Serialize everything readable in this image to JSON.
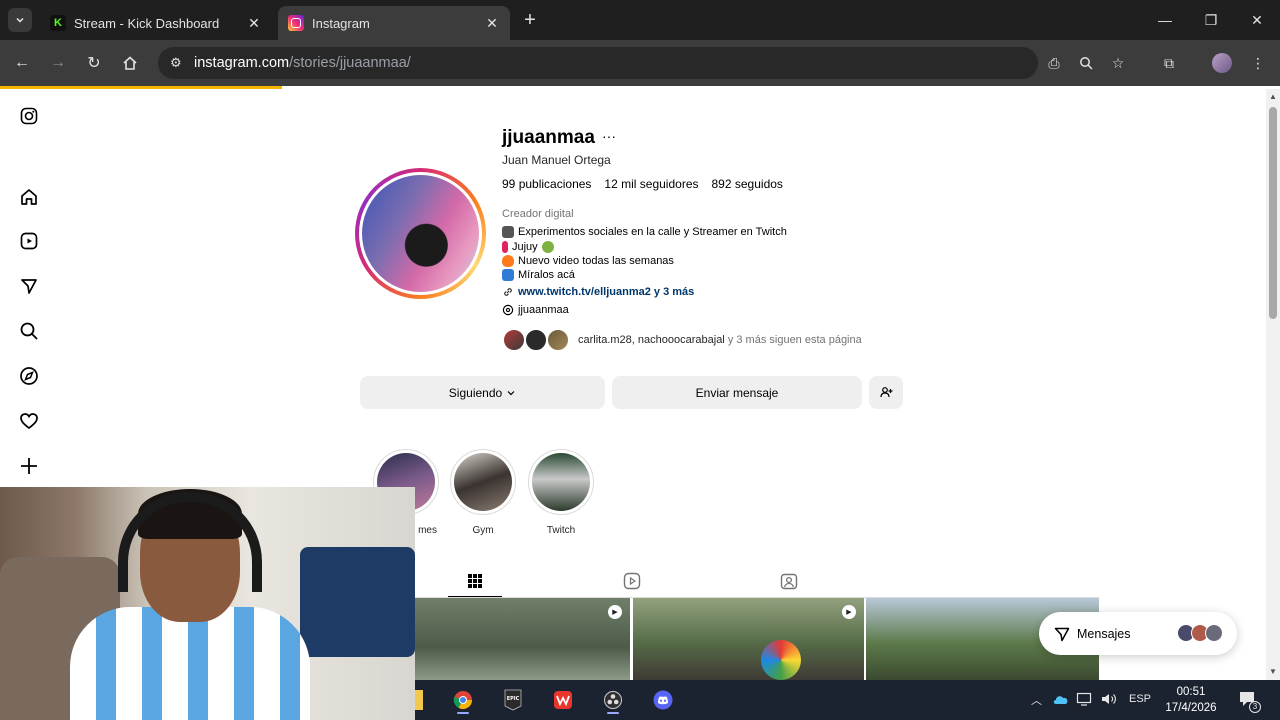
{
  "browser": {
    "tabs": [
      {
        "title": "Stream - Kick Dashboard",
        "active": false
      },
      {
        "title": "Instagram",
        "active": true
      }
    ],
    "url_host": "instagram.com",
    "url_path": "/stories/jjuaanmaa/"
  },
  "profile": {
    "username": "jjuaanmaa",
    "more": "···",
    "full_name": "Juan Manuel Ortega",
    "stats": {
      "posts_value": "99",
      "posts_label": "publicaciones",
      "followers_value": "12 mil",
      "followers_label": "seguidores",
      "following_value": "892",
      "following_label": "seguidos"
    },
    "category": "Creador digital",
    "bio": [
      "Experimentos sociales en la calle y Streamer en Twitch",
      "Jujuy",
      "Nuevo video todas las semanas",
      "Míralos acá"
    ],
    "link": "www.twitch.tv/elljuanma2 y 3 más",
    "threads": "jjuaanmaa",
    "followed_by_names": "carlita.m28, nachooocarabajal",
    "followed_by_rest": " y 3 más siguen esta página"
  },
  "actions": {
    "following_label": "Siguiendo",
    "message_label": "Enviar mensaje"
  },
  "highlights": [
    {
      "label": "mes"
    },
    {
      "label": "Gym"
    },
    {
      "label": "Twitch"
    }
  ],
  "messages": {
    "label": "Mensajes"
  },
  "taskbar": {
    "language": "ESP",
    "time": "00:51",
    "date": "17/4/2026",
    "notifications": "3"
  },
  "colors": {
    "accent_link": "#00376b",
    "loading_bar": "#f5b400",
    "chrome_dark": "#1f1f1f"
  }
}
